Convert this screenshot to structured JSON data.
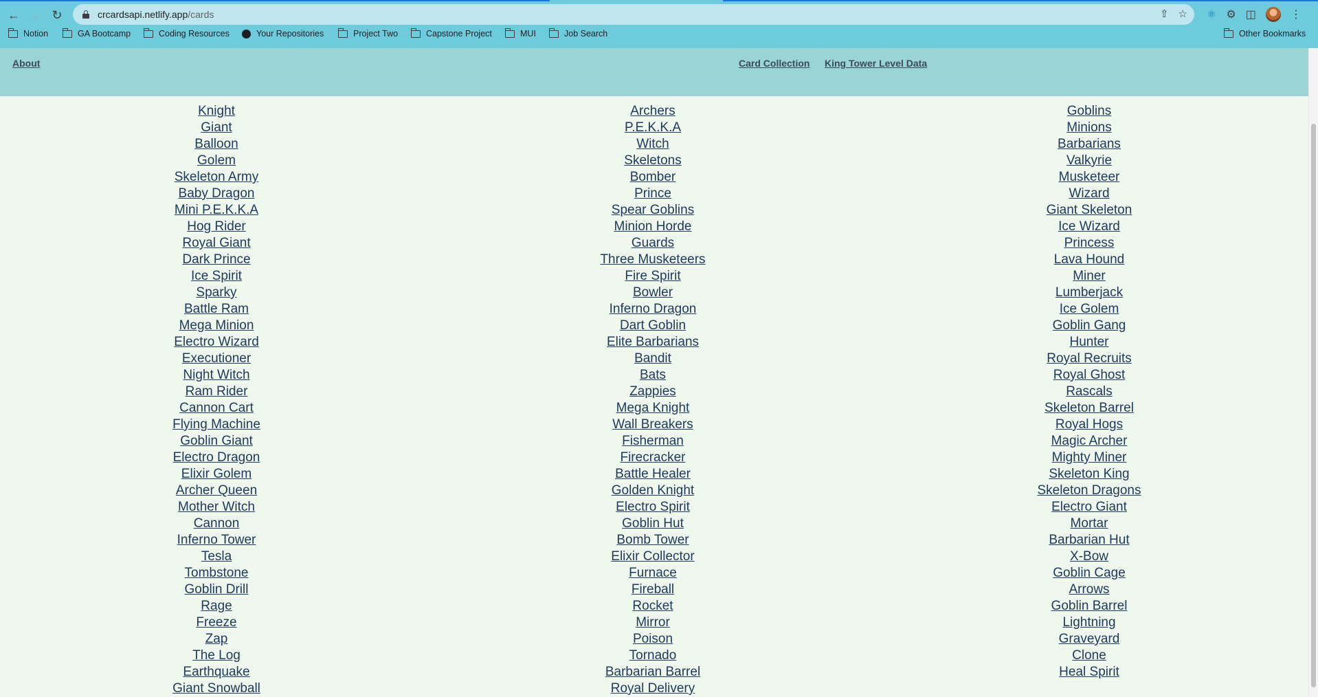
{
  "browser": {
    "url_host": "crcardsapi.netlify.app",
    "url_path": "/cards",
    "bookmarks": [
      {
        "label": "Notion",
        "icon": "folder-icon"
      },
      {
        "label": "GA Bootcamp",
        "icon": "folder-icon"
      },
      {
        "label": "Coding Resources",
        "icon": "folder-icon"
      },
      {
        "label": "Your Repositories",
        "icon": "github-icon"
      },
      {
        "label": "Project Two",
        "icon": "folder-icon"
      },
      {
        "label": "Capstone Project",
        "icon": "folder-icon"
      },
      {
        "label": "MUI",
        "icon": "folder-icon"
      },
      {
        "label": "Job Search",
        "icon": "folder-icon"
      }
    ],
    "other_bookmarks": "Other Bookmarks"
  },
  "nav": {
    "about": "About",
    "card_collection": "Card Collection",
    "king_tower": "King Tower Level Data"
  },
  "cards": {
    "col1": [
      "Knight",
      "Giant",
      "Balloon",
      "Golem",
      "Skeleton Army",
      "Baby Dragon",
      "Mini P.E.K.K.A",
      "Hog Rider",
      "Royal Giant",
      "Dark Prince",
      "Ice Spirit",
      "Sparky",
      "Battle Ram",
      "Mega Minion",
      "Electro Wizard",
      "Executioner",
      "Night Witch",
      "Ram Rider",
      "Cannon Cart",
      "Flying Machine",
      "Goblin Giant",
      "Electro Dragon",
      "Elixir Golem",
      "Archer Queen",
      "Mother Witch",
      "Cannon",
      "Inferno Tower",
      "Tesla",
      "Tombstone",
      "Goblin Drill",
      "Rage",
      "Freeze",
      "Zap",
      "The Log",
      "Earthquake",
      "Giant Snowball"
    ],
    "col2": [
      "Archers",
      "P.E.K.K.A",
      "Witch",
      "Skeletons",
      "Bomber",
      "Prince",
      "Spear Goblins",
      "Minion Horde",
      "Guards",
      "Three Musketeers",
      "Fire Spirit",
      "Bowler",
      "Inferno Dragon",
      "Dart Goblin",
      "Elite Barbarians",
      "Bandit",
      "Bats",
      "Zappies",
      "Mega Knight",
      "Wall Breakers",
      "Fisherman",
      "Firecracker",
      "Battle Healer",
      "Golden Knight",
      "Electro Spirit",
      "Goblin Hut",
      "Bomb Tower",
      "Elixir Collector",
      "Furnace",
      "Fireball",
      "Rocket",
      "Mirror",
      "Poison",
      "Tornado",
      "Barbarian Barrel",
      "Royal Delivery"
    ],
    "col3": [
      "Goblins",
      "Minions",
      "Barbarians",
      "Valkyrie",
      "Musketeer",
      "Wizard",
      "Giant Skeleton",
      "Ice Wizard",
      "Princess",
      "Lava Hound",
      "Miner",
      "Lumberjack",
      "Ice Golem",
      "Goblin Gang",
      "Hunter",
      "Royal Recruits",
      "Royal Ghost",
      "Rascals",
      "Skeleton Barrel",
      "Royal Hogs",
      "Magic Archer",
      "Mighty Miner",
      "Skeleton King",
      "Skeleton Dragons",
      "Electro Giant",
      "Mortar",
      "Barbarian Hut",
      "X-Bow",
      "Goblin Cage",
      "Arrows",
      "Goblin Barrel",
      "Lightning",
      "Graveyard",
      "Clone",
      "Heal Spirit"
    ]
  }
}
